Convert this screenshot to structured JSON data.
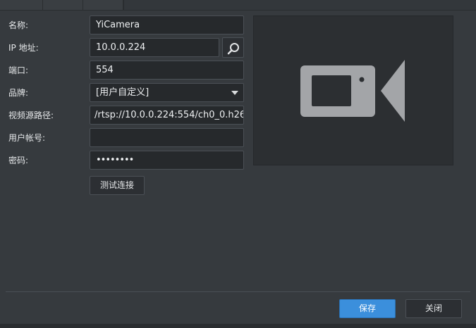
{
  "form": {
    "name_label": "名称:",
    "name_value": "YiCamera",
    "ip_label": "IP 地址:",
    "ip_value": "10.0.0.224",
    "port_label": "端口:",
    "port_value": "554",
    "brand_label": "品牌:",
    "brand_value": "[用户自定义]",
    "path_label": "视频源路径:",
    "path_value": "/rtsp://10.0.0.224:554/ch0_0.h26",
    "user_label": "用户帐号:",
    "user_value": "",
    "password_label": "密码:",
    "password_value": "••••••••",
    "test_button": "测试连接"
  },
  "footer": {
    "save_button": "保存",
    "close_button": "关闭"
  },
  "icons": {
    "search": "search-icon",
    "dropdown": "chevron-down-icon",
    "preview": "video-camera-icon"
  },
  "colors": {
    "accent": "#3b8fdc",
    "background": "#363a3e",
    "field_background": "#26292c"
  }
}
